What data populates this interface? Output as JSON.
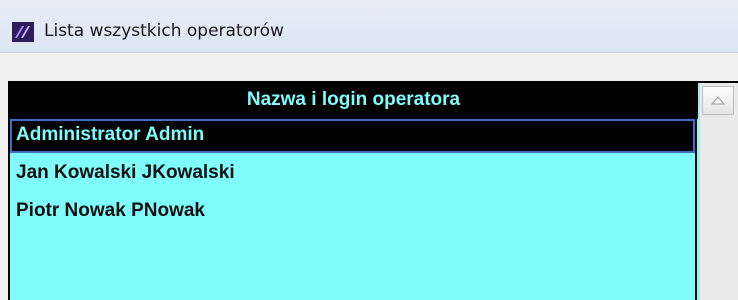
{
  "window": {
    "title": "Lista wszystkich operatorów",
    "icon": "app-logo-icon"
  },
  "list": {
    "header": "Nazwa i login operatora",
    "rows": [
      "Administrator Admin",
      "Jan Kowalski JKowalski",
      "Piotr Nowak PNowak"
    ],
    "selected_index": 0
  },
  "scrollbar": {
    "up_icon": "chevron-up-icon"
  },
  "colors": {
    "list_background": "#7ffcfc",
    "header_background": "#000000",
    "selection_outline": "#3b6fc9"
  }
}
